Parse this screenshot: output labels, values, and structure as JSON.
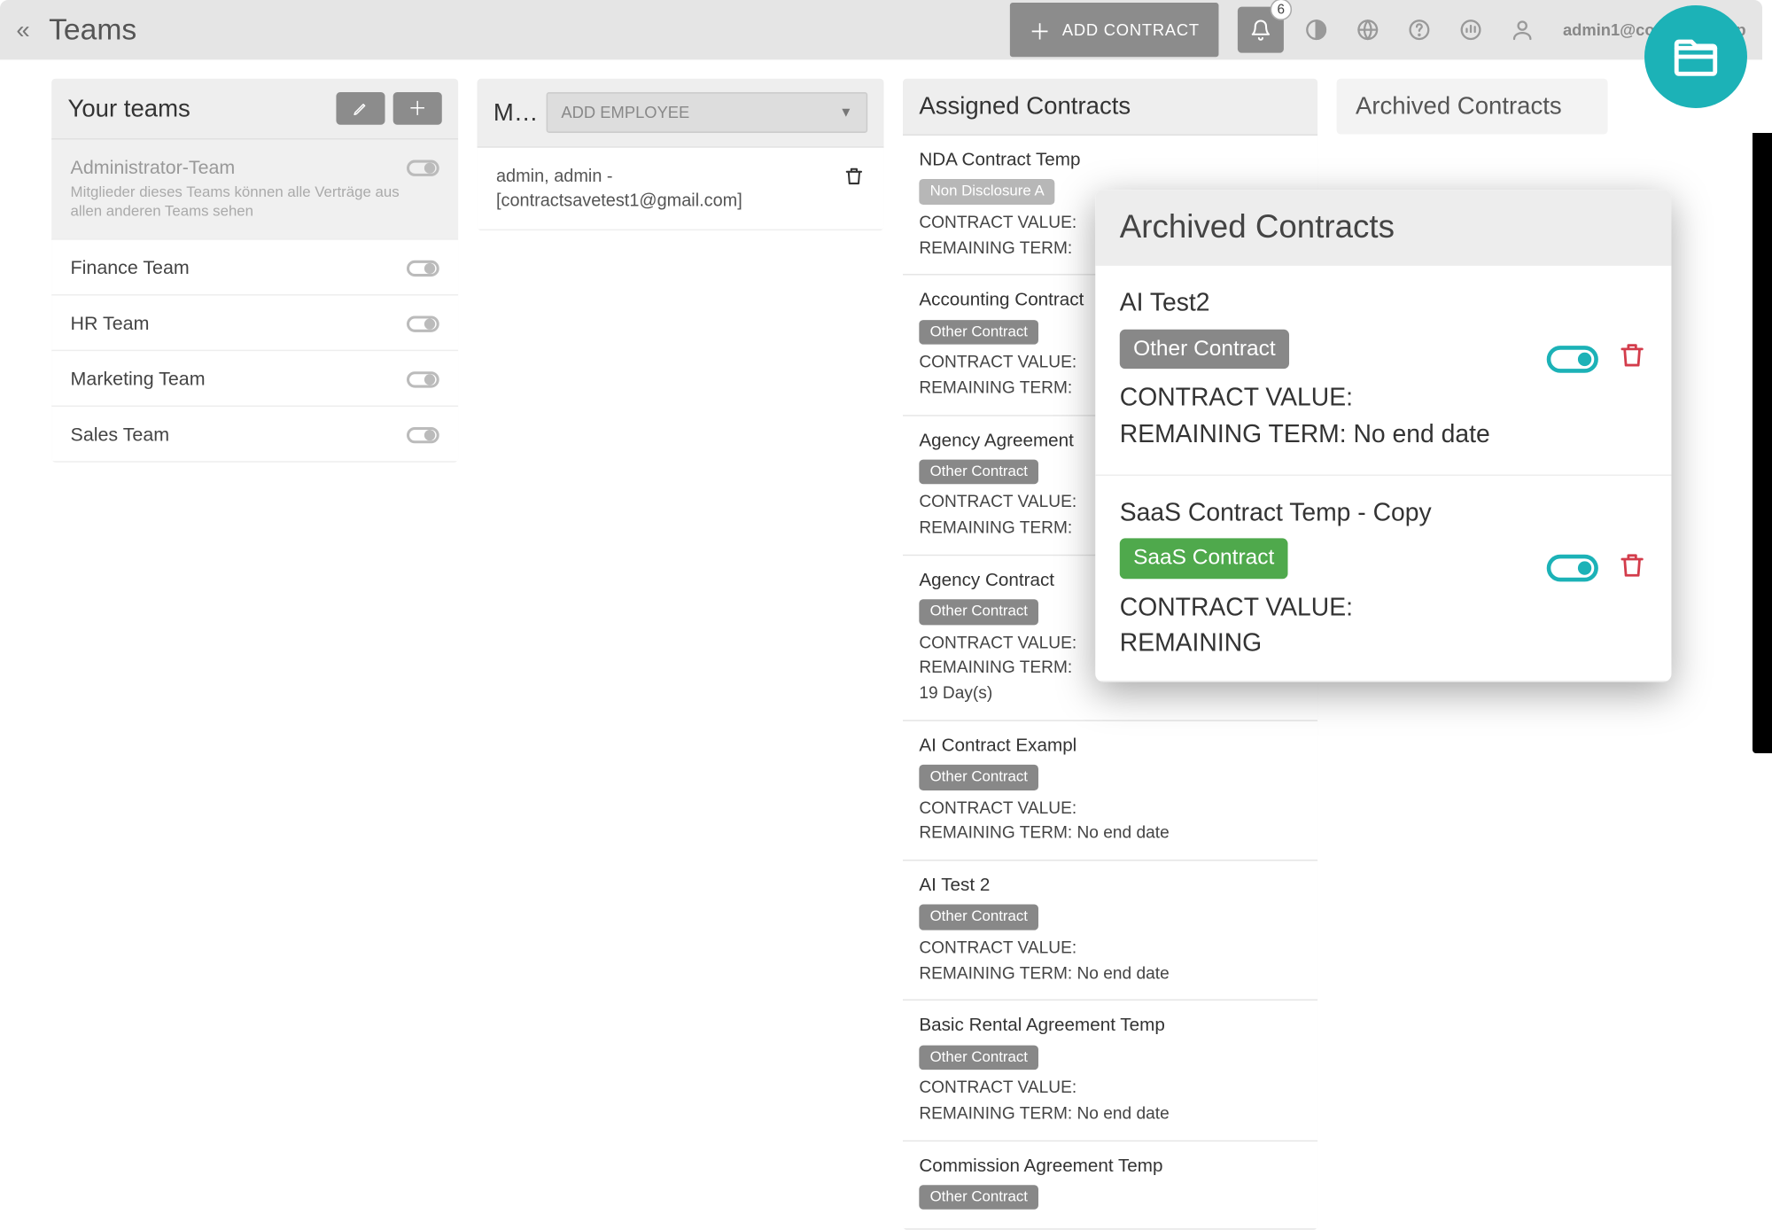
{
  "header": {
    "page_title": "Teams",
    "add_contract_label": "ADD CONTRACT",
    "bell_badge": "6",
    "user_label": "admin1@contractsavep"
  },
  "teams_col": {
    "title": "Your teams",
    "admin": {
      "name": "Administrator-Team",
      "desc": "Mitglieder dieses Teams können alle Verträge aus allen anderen Teams sehen"
    },
    "items": [
      {
        "name": "Finance Team"
      },
      {
        "name": "HR Team"
      },
      {
        "name": "Marketing Team"
      },
      {
        "name": "Sales Team"
      }
    ]
  },
  "members_col": {
    "title_short": "M…",
    "add_employee_placeholder": "ADD EMPLOYEE",
    "member_line1": "admin, admin -",
    "member_line2": "[contractsavetest1@gmail.com]"
  },
  "assigned_col": {
    "title": "Assigned Contracts",
    "cards": [
      {
        "title": "NDA Contract Temp",
        "tag": "Non Disclosure A",
        "tag_class": "tag-muted",
        "value": "CONTRACT VALUE:",
        "term": "REMAINING TERM:"
      },
      {
        "title": "Accounting Contract",
        "tag": "Other Contract",
        "tag_class": "tag-gray",
        "value": "CONTRACT VALUE:",
        "term": "REMAINING TERM:"
      },
      {
        "title": "Agency Agreement",
        "tag": "Other Contract",
        "tag_class": "tag-gray",
        "value": "CONTRACT VALUE:",
        "term": "REMAINING TERM:"
      },
      {
        "title": "Agency Contract",
        "tag": "Other Contract",
        "tag_class": "tag-gray",
        "value": "CONTRACT VALUE:",
        "term": "REMAINING TERM:\n19 Day(s)"
      },
      {
        "title": "AI Contract Exampl",
        "tag": "Other Contract",
        "tag_class": "tag-gray",
        "value": "CONTRACT VALUE:",
        "term": "REMAINING TERM: No end date"
      },
      {
        "title": "AI Test 2",
        "tag": "Other Contract",
        "tag_class": "tag-gray",
        "value": "CONTRACT VALUE:",
        "term": "REMAINING TERM: No end date"
      },
      {
        "title": "Basic Rental Agreement Temp",
        "tag": "Other Contract",
        "tag_class": "tag-gray",
        "value": "CONTRACT VALUE:",
        "term": "REMAINING TERM: No end date"
      },
      {
        "title": "Commission Agreement Temp",
        "tag": "Other Contract",
        "tag_class": "tag-gray",
        "value": "",
        "term": ""
      }
    ]
  },
  "archived_bg_title": "Archived Contracts",
  "popup": {
    "title": "Archived Contracts",
    "cards": [
      {
        "title": "AI Test2",
        "tag": "Other Contract",
        "tag_class": "tag-gray",
        "value": "CONTRACT VALUE:",
        "term": "REMAINING TERM: No end date"
      },
      {
        "title": "SaaS Contract Temp - Copy",
        "tag": "SaaS Contract",
        "tag_class": "tag-green",
        "value": "CONTRACT VALUE:",
        "term": "REMAINING"
      }
    ]
  }
}
